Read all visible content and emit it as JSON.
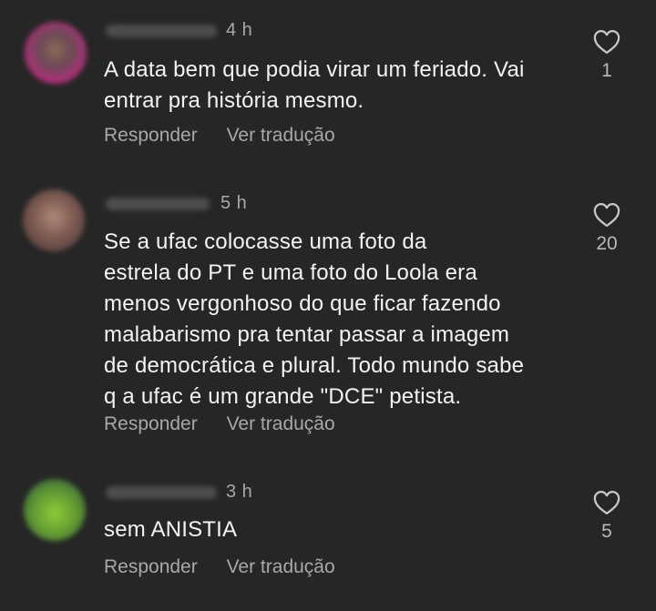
{
  "comments": [
    {
      "time": "4 h",
      "text_lines": [
        "A data bem que podia virar um feriado. Vai",
        "entrar pra história mesmo."
      ],
      "reply_label": "Responder",
      "translate_label": "Ver tradução",
      "likes": "1"
    },
    {
      "time": "5 h",
      "text_lines": [
        "Se a ufac colocasse uma foto da",
        "estrela do PT e uma foto do Loola era",
        "menos vergonhoso do que ficar fazendo",
        "malabarismo pra tentar passar a imagem",
        "de democrática e plural. Todo mundo sabe",
        "q a ufac é um grande \"DCE\"  petista."
      ],
      "reply_label": "Responder",
      "translate_label": "Ver tradução",
      "likes": "20"
    },
    {
      "time": "3 h",
      "text_lines": [
        "sem ANISTIA"
      ],
      "reply_label": "Responder",
      "translate_label": "Ver tradução",
      "likes": "5"
    }
  ],
  "icons": {
    "like": "heart-outline-icon"
  },
  "colors": {
    "background": "#262626",
    "text": "#f3f3f3",
    "muted": "#a8a8a8"
  }
}
